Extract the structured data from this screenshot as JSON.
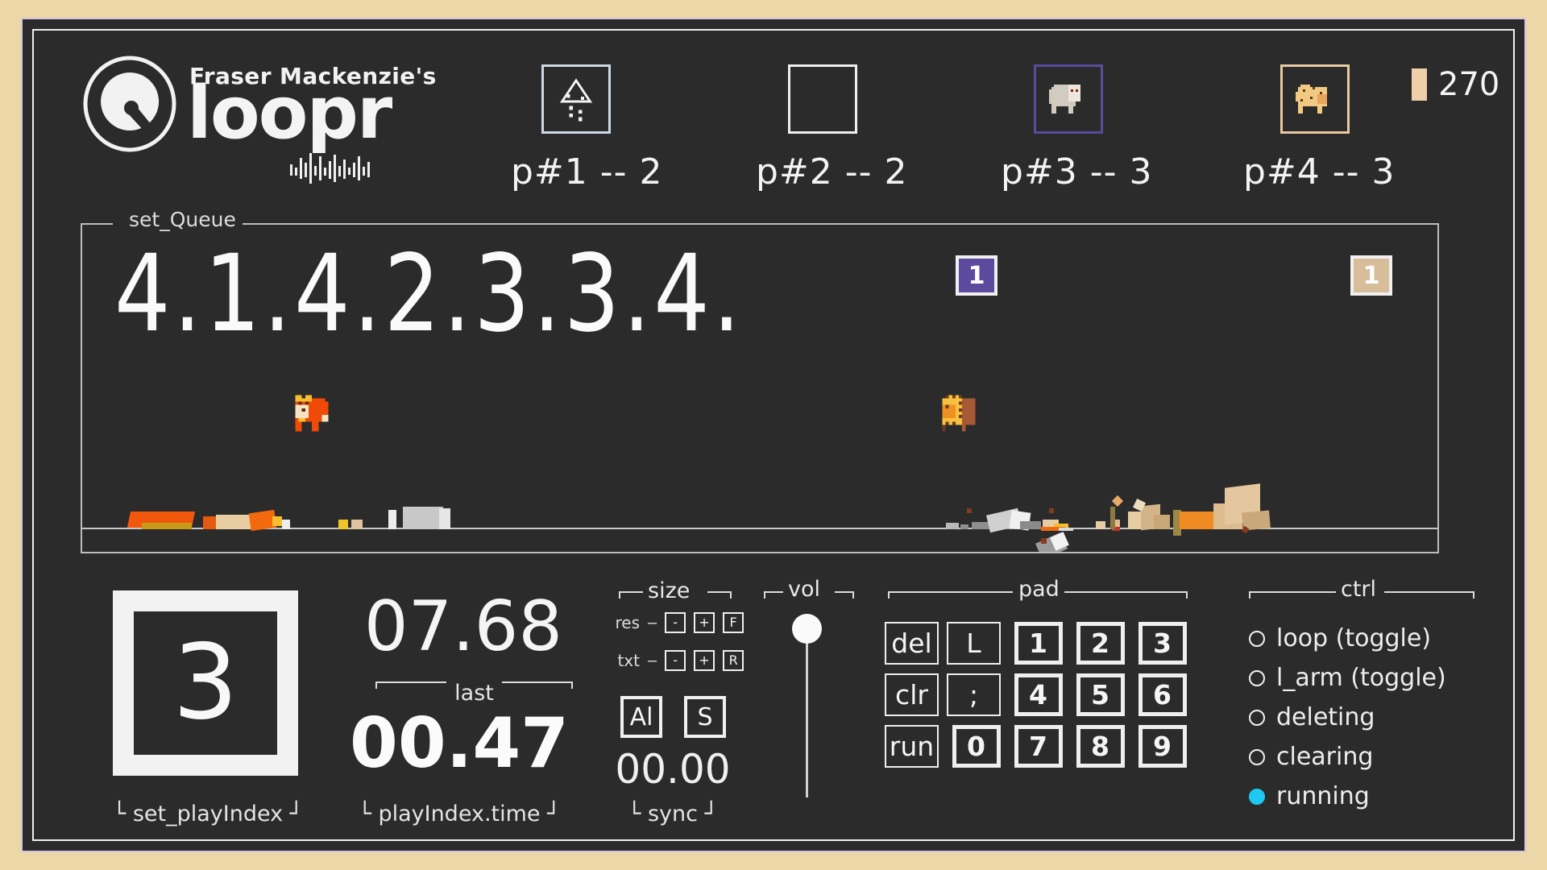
{
  "app": {
    "brand_top": "Fraser Mackenzie's",
    "brand_main": "loopr",
    "bg_color": "#ecd7a8",
    "panel_color": "#2b2b2b",
    "accent_running": "#1ec8f0",
    "accent_purple": "#5b4a9e",
    "accent_tan": "#e8c9a0"
  },
  "top_pads": [
    {
      "label": "p#1 -- 2",
      "id": "p#1",
      "count": "2",
      "border_color": "#cdd9e3",
      "sprite": "tree-sprite",
      "selected": "false"
    },
    {
      "label": "p#2 -- 2",
      "id": "p#2",
      "count": "2",
      "border_color": "#efefef",
      "sprite": "none",
      "selected": "false"
    },
    {
      "label": "p#3 -- 3",
      "id": "p#3",
      "count": "3",
      "border_color": "#5b4a9e",
      "sprite": "sheep-sprite",
      "selected": "true"
    },
    {
      "label": "p#4 -- 3",
      "id": "p#4",
      "count": "3",
      "border_color": "#e8c9a0",
      "sprite": "pig-sprite",
      "selected": "true"
    }
  ],
  "counter": {
    "value": "270",
    "bar_color": "#eecfa8"
  },
  "queue": {
    "legend": "set_Queue",
    "string": "4.1.4.2.3.3.4.",
    "badges": [
      {
        "value": "1",
        "color": "#5b4a9e"
      },
      {
        "value": "1",
        "color": "#d8bd9a"
      }
    ]
  },
  "playindex": {
    "value": "3",
    "caption": "└ set_playIndex ┘"
  },
  "timers": {
    "last_value": "07.68",
    "last_label": "last",
    "playindex_time_value": "00.47",
    "playindex_time_caption": "└ playIndex.time ┘"
  },
  "size": {
    "title": "size",
    "rows": [
      {
        "label": "res",
        "buttons": [
          "-",
          "+",
          "F"
        ]
      },
      {
        "label": "txt",
        "buttons": [
          "-",
          "+",
          "R"
        ]
      }
    ],
    "big_buttons": [
      "Al",
      "S"
    ],
    "sync_value": "00.00",
    "sync_caption": "└ sync ┘"
  },
  "vol": {
    "title": "vol",
    "level": "100"
  },
  "pad": {
    "title": "pad",
    "keys": [
      {
        "label": "del",
        "type": "cmd"
      },
      {
        "label": "L",
        "type": "cmd"
      },
      {
        "label": "1",
        "type": "num"
      },
      {
        "label": "2",
        "type": "num"
      },
      {
        "label": "3",
        "type": "num"
      },
      {
        "label": "clr",
        "type": "cmd"
      },
      {
        "label": ";",
        "type": "cmd"
      },
      {
        "label": "4",
        "type": "num"
      },
      {
        "label": "5",
        "type": "num"
      },
      {
        "label": "6",
        "type": "num"
      },
      {
        "label": "run",
        "type": "cmd"
      },
      {
        "label": "0",
        "type": "num"
      },
      {
        "label": "7",
        "type": "num"
      },
      {
        "label": "8",
        "type": "num"
      },
      {
        "label": "9",
        "type": "num"
      }
    ]
  },
  "ctrl": {
    "title": "ctrl",
    "items": [
      {
        "label": "loop (toggle)",
        "active": false
      },
      {
        "label": "l_arm (toggle)",
        "active": false
      },
      {
        "label": "deleting",
        "active": false
      },
      {
        "label": "clearing",
        "active": false
      },
      {
        "label": "running",
        "active": true
      }
    ]
  }
}
